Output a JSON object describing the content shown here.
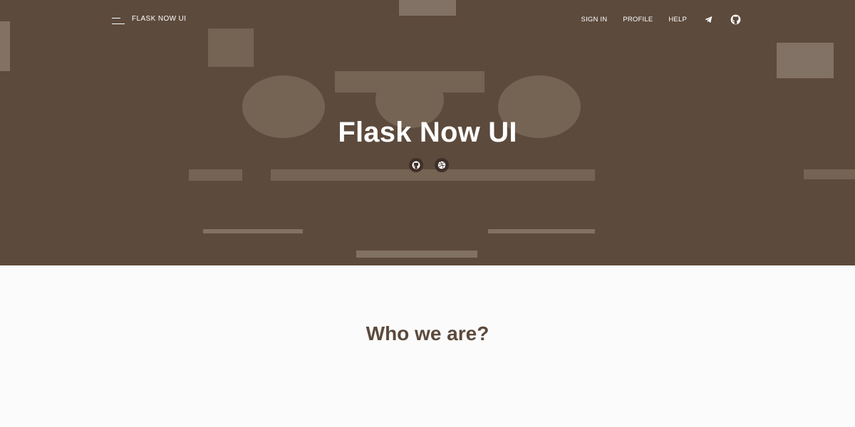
{
  "navbar": {
    "brand": "FLASK NOW UI",
    "links": [
      "SIGN IN",
      "PROFILE",
      "HELP"
    ],
    "icons": [
      "telegram-icon",
      "github-icon"
    ]
  },
  "hero": {
    "title": "Flask Now UI",
    "buttons": [
      "github-icon",
      "dribbble-icon"
    ]
  },
  "about": {
    "title": "Who we are?",
    "text": ""
  },
  "colors": {
    "hero_bg": "#5c4a3c",
    "accent_text": "#5c4a3c",
    "page_bg": "#fbfbfb"
  }
}
